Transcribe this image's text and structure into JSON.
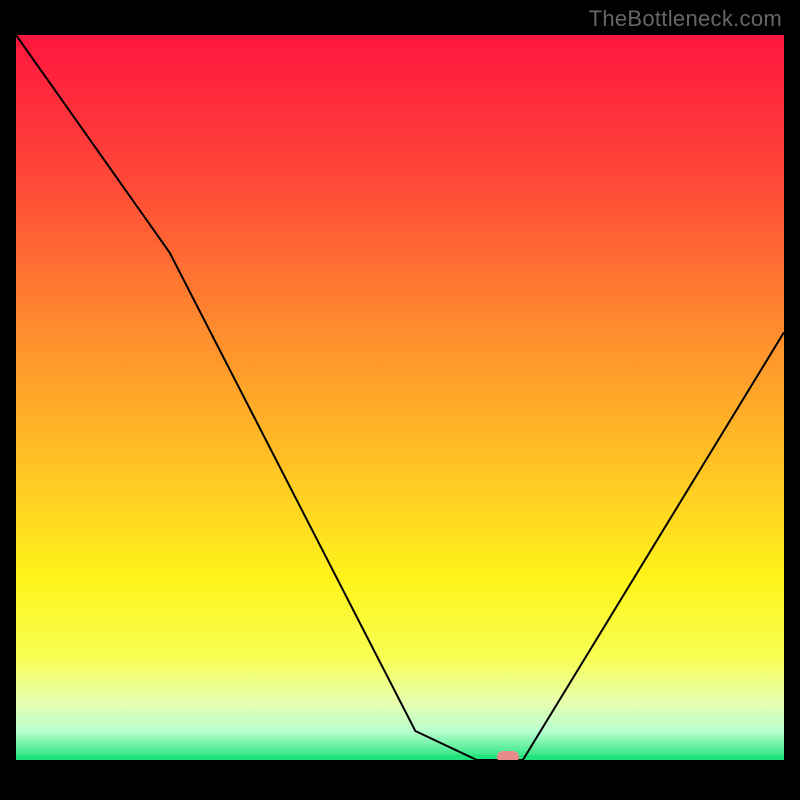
{
  "watermark": "TheBottleneck.com",
  "colors": {
    "gradient_stops": [
      {
        "offset": 0.0,
        "color": "#ff153f"
      },
      {
        "offset": 0.2,
        "color": "#ff4838"
      },
      {
        "offset": 0.4,
        "color": "#ff8a2e"
      },
      {
        "offset": 0.6,
        "color": "#ffc524"
      },
      {
        "offset": 0.75,
        "color": "#fff31a"
      },
      {
        "offset": 0.86,
        "color": "#f7ff55"
      },
      {
        "offset": 0.92,
        "color": "#e8ffb0"
      },
      {
        "offset": 0.96,
        "color": "#b9ffcf"
      },
      {
        "offset": 1.0,
        "color": "#20e37a"
      }
    ],
    "curve": "#000000",
    "marker": "#e68a8a",
    "background": "#000000"
  },
  "chart_data": {
    "type": "line",
    "title": "",
    "xlabel": "",
    "ylabel": "",
    "xlim": [
      0,
      100
    ],
    "ylim": [
      0,
      100
    ],
    "x": [
      0,
      20,
      52,
      60,
      66,
      100
    ],
    "values": [
      100,
      70,
      4,
      0,
      0,
      59
    ],
    "baseline_y": 0,
    "marker": {
      "x": 64,
      "y": 0
    },
    "notes": "V-shaped bottleneck curve over red→green vertical gradient. Minimum (optimal) at x≈60–66 where value hits 0; marker indicates optimal point."
  }
}
